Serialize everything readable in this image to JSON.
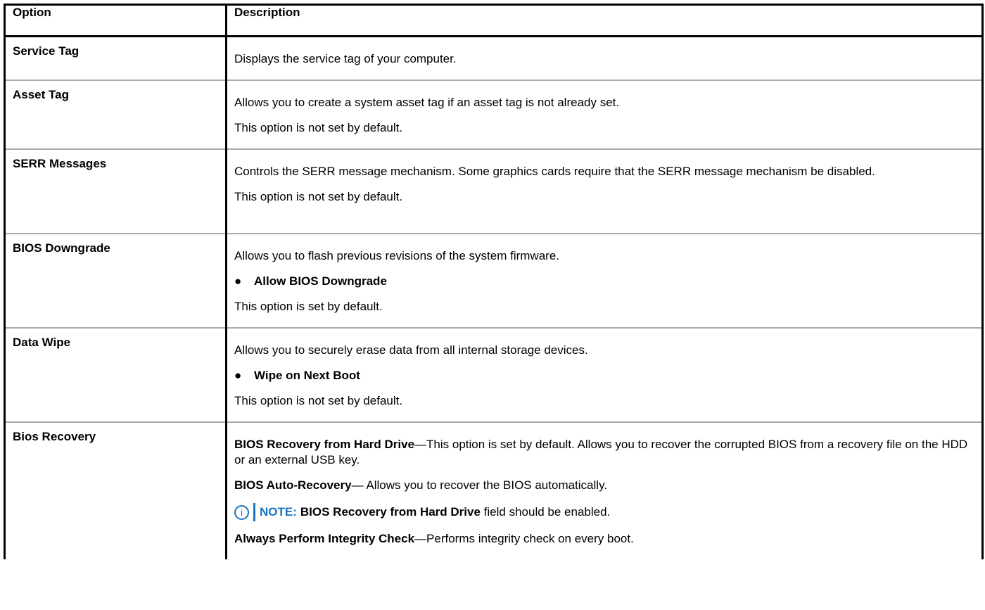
{
  "header": {
    "option": "Option",
    "description": "Description"
  },
  "rows": [
    {
      "name": "Service Tag",
      "p1": "Displays the service tag of your computer."
    },
    {
      "name": "Asset Tag",
      "p1": "Allows you to create a system asset tag if an asset tag is not already set.",
      "p2": "This option is not set by default."
    },
    {
      "name": "SERR Messages",
      "p1": "Controls the SERR message mechanism. Some graphics cards require that the SERR message mechanism be disabled.",
      "p2": "This option is not set by default."
    },
    {
      "name": "BIOS Downgrade",
      "p1": "Allows you to flash previous revisions of the system firmware.",
      "bullet": "Allow BIOS Downgrade",
      "p2": "This option is set by default."
    },
    {
      "name": "Data Wipe",
      "p1": "Allows you to securely erase data from all internal storage devices.",
      "bullet": "Wipe on Next Boot",
      "p2": "This option is not set by default."
    },
    {
      "name": "Bios Recovery",
      "item1_term": "BIOS Recovery from Hard Drive",
      "item1_text": "—This option is set by default. Allows you to recover the corrupted BIOS from a recovery file on the HDD or an external USB key.",
      "item2_term": "BIOS Auto-Recovery",
      "item2_text": "— Allows you to recover the BIOS automatically.",
      "note_label": "NOTE:",
      "note_term": "BIOS Recovery from Hard Drive",
      "note_text": "field should be enabled.",
      "item3_term": "Always Perform Integrity Check",
      "item3_text": "—Performs integrity check on every boot."
    }
  ],
  "bullet_symbol": "●",
  "icons": {
    "note": "info-icon",
    "note_color": "#1a73c7"
  }
}
